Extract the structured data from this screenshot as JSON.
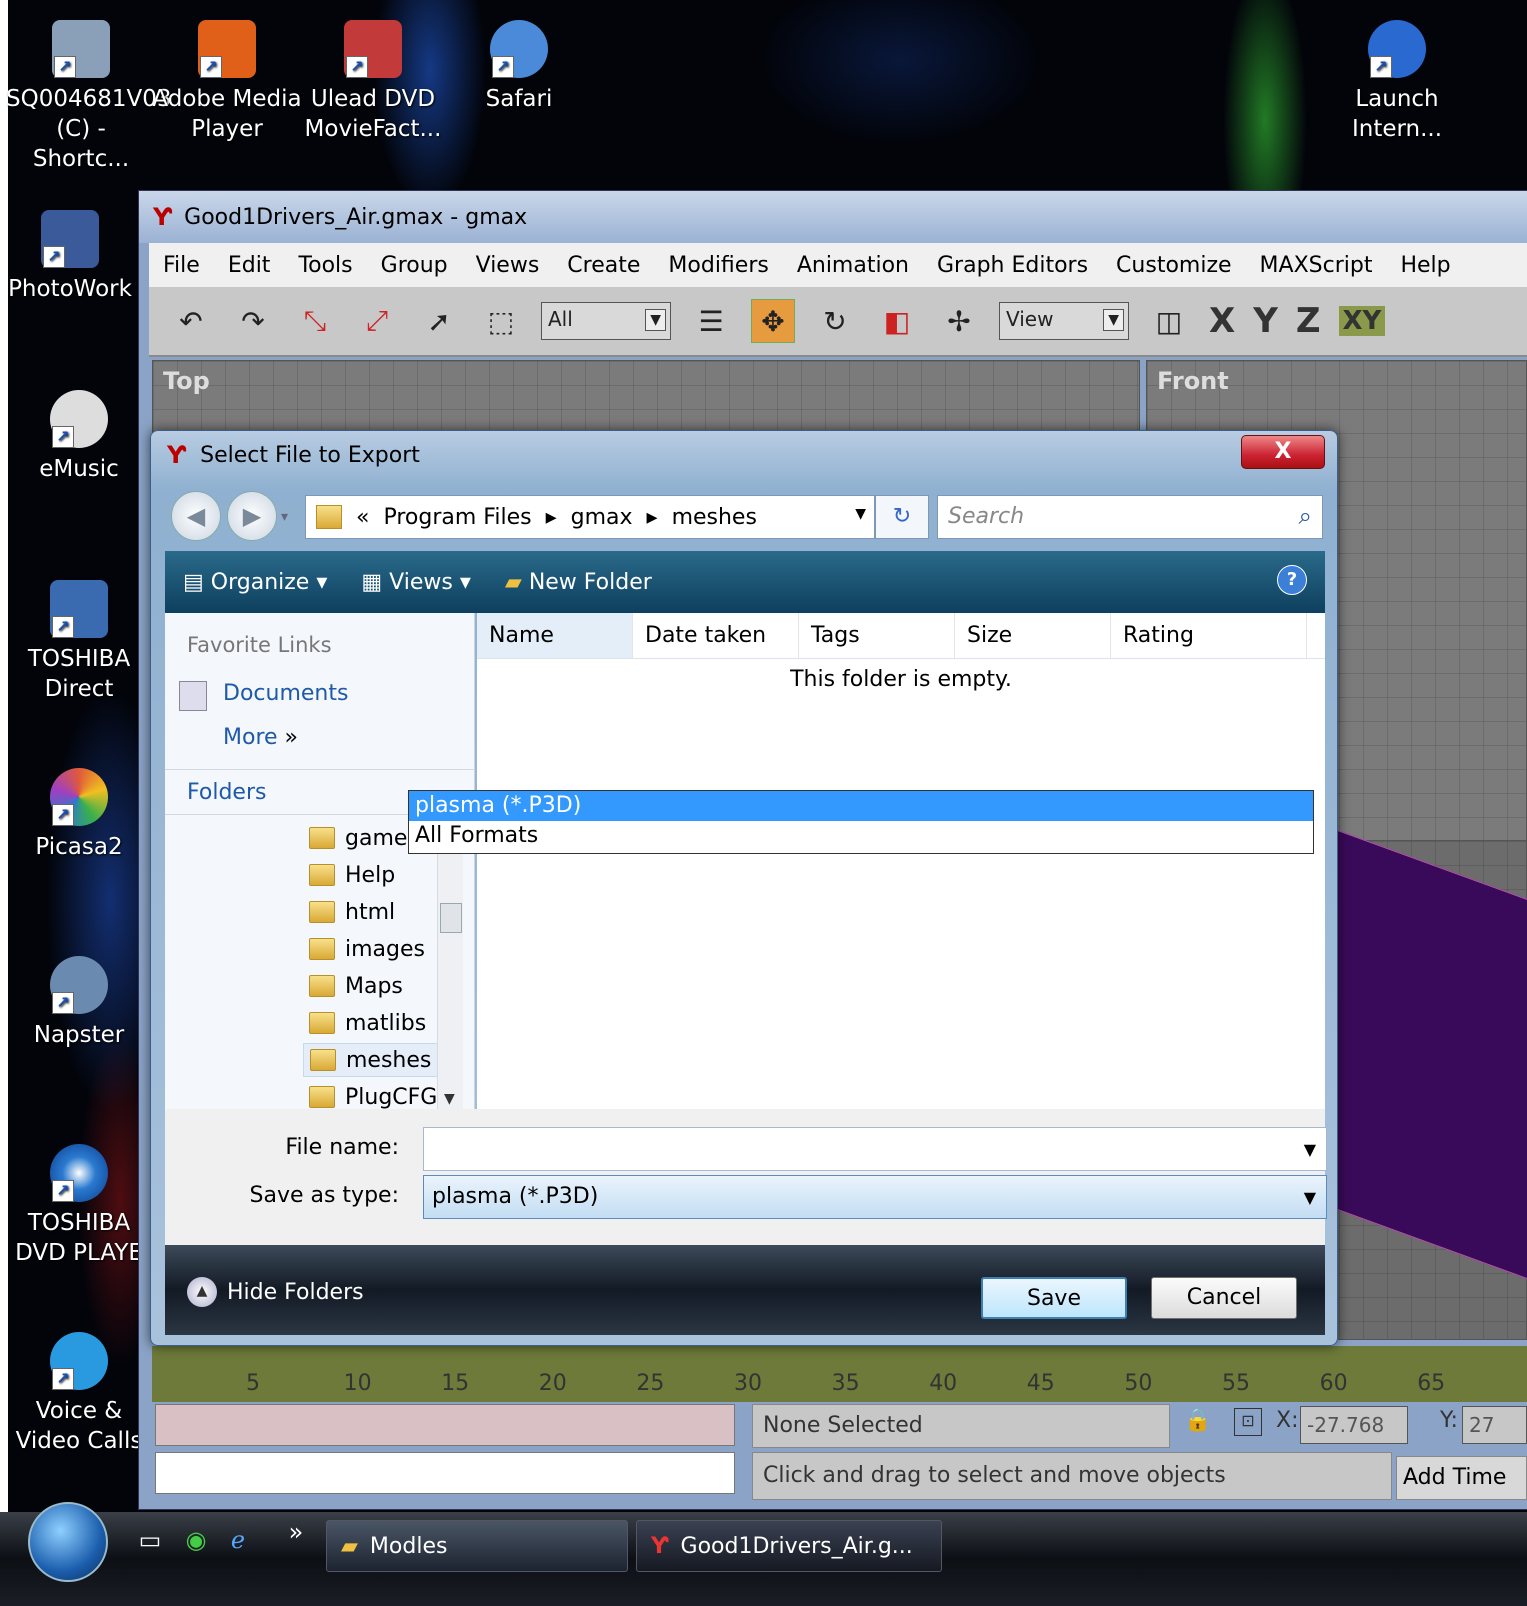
{
  "desktop": {
    "icons": [
      {
        "label1": "SQ004681V03",
        "label2": "(C) - Shortc...",
        "color": "#8aa0b8"
      },
      {
        "label1": "Adobe Media",
        "label2": "Player",
        "color": "#e0601a"
      },
      {
        "label1": "Ulead DVD",
        "label2": "MovieFact...",
        "color": "#c23a3a"
      },
      {
        "label1": "Safari",
        "label2": "",
        "color": "#4a8ad8"
      },
      {
        "label1": "Launch",
        "label2": "Intern...",
        "color": "#2a6ad0"
      },
      {
        "label1": "PhotoWork",
        "label2": "",
        "color": "#3a5a9a"
      },
      {
        "label1": "eMusic",
        "label2": "",
        "color": "#dddddd"
      },
      {
        "label1": "TOSHIBA",
        "label2": "Direct",
        "color": "#3a6ab0"
      },
      {
        "label1": "Picasa2",
        "label2": "",
        "color": "#e05a3a"
      },
      {
        "label1": "Napster",
        "label2": "",
        "color": "#6a8ab0"
      },
      {
        "label1": "TOSHIBA",
        "label2": "DVD PLAYE",
        "color": "#2a7ad0"
      },
      {
        "label1": "Voice &",
        "label2": "Video Calls",
        "color": "#2a9ae0"
      }
    ]
  },
  "gmax": {
    "title": "Good1Drivers_Air.gmax - gmax",
    "menu": [
      "File",
      "Edit",
      "Tools",
      "Group",
      "Views",
      "Create",
      "Modifiers",
      "Animation",
      "Graph Editors",
      "Customize",
      "MAXScript",
      "Help"
    ],
    "filter_select": "All",
    "view_select": "View",
    "axes": [
      "X",
      "Y",
      "Z",
      "XY"
    ],
    "viewport_top": "Top",
    "viewport_front": "Front",
    "timeline_ticks": [
      "5",
      "10",
      "15",
      "20",
      "25",
      "30",
      "35",
      "40",
      "45",
      "50",
      "55",
      "60",
      "65"
    ],
    "status": "None Selected",
    "prompt": "Click and drag to select and move objects",
    "x_label": "X:",
    "x_value": "-27.768",
    "y_label": "Y:",
    "y_value": "27",
    "add_time": "Add Time"
  },
  "dialog": {
    "title": "Select File to Export",
    "close_label": "X",
    "breadcrumb": [
      "«",
      "Program Files",
      "▸",
      "gmax",
      "▸",
      "meshes"
    ],
    "search_placeholder": "Search",
    "toolbar": {
      "organize": "Organize",
      "views": "Views",
      "new_folder": "New Folder",
      "help": "?"
    },
    "favorite_links": "Favorite Links",
    "links": [
      "Documents",
      "More"
    ],
    "more_glyph": "»",
    "folders_label": "Folders",
    "tree": [
      "gamepac",
      "Help",
      "html",
      "images",
      "Maps",
      "matlibs",
      "meshes",
      "PlugCFG"
    ],
    "columns": [
      "Name",
      "Date taken",
      "Tags",
      "Size",
      "Rating"
    ],
    "empty_message": "This folder is empty.",
    "file_name_label": "File name:",
    "file_name_value": "",
    "save_type_label": "Save as type:",
    "save_type_value": "plasma (*.P3D)",
    "type_options": [
      "plasma (*.P3D)",
      "All Formats"
    ],
    "hide_folders": "Hide Folders",
    "save": "Save",
    "cancel": "Cancel"
  },
  "taskbar": {
    "more": "»",
    "buttons": [
      "Modles",
      "Good1Drivers_Air.g..."
    ]
  }
}
